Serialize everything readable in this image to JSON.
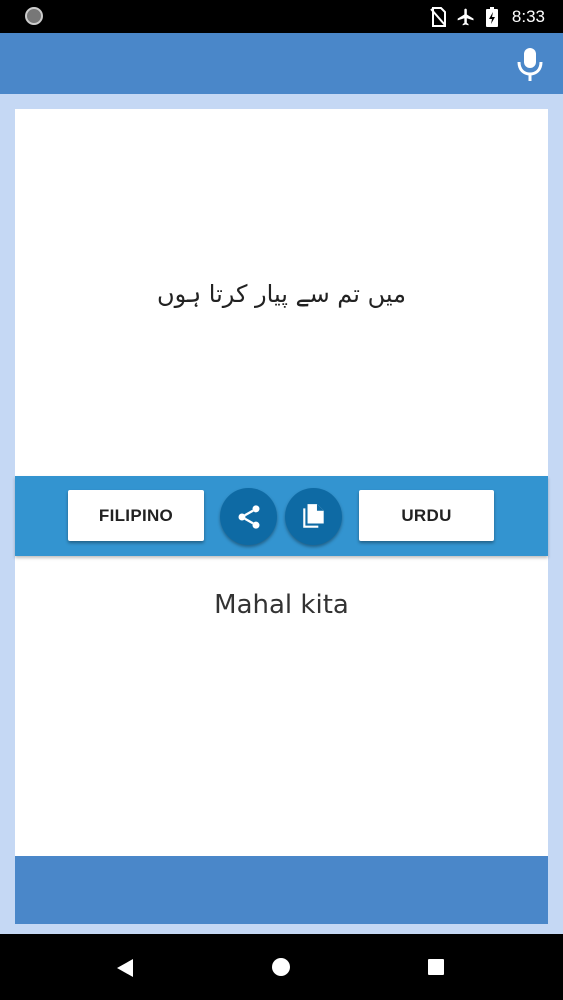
{
  "status_bar": {
    "time": "8:33",
    "icons": [
      "no-sim-icon",
      "airplane-mode-icon",
      "battery-charging-icon"
    ]
  },
  "app_bar": {
    "icon": "microphone-icon"
  },
  "source": {
    "text": "میں تم سے پیار کرتا ہوں"
  },
  "toolbar": {
    "left_language": "FILIPINO",
    "right_language": "URDU",
    "share_icon": "share-icon",
    "copy_icon": "copy-icon"
  },
  "target": {
    "text": "Mahal kita"
  },
  "nav_bar": {
    "icons": [
      "back-icon",
      "home-icon",
      "recents-icon"
    ]
  },
  "colors": {
    "app_bar": "#4a87c9",
    "toolbar": "#3394d0",
    "round_button": "#0e6aa4",
    "page_background": "#c5d8f4"
  }
}
